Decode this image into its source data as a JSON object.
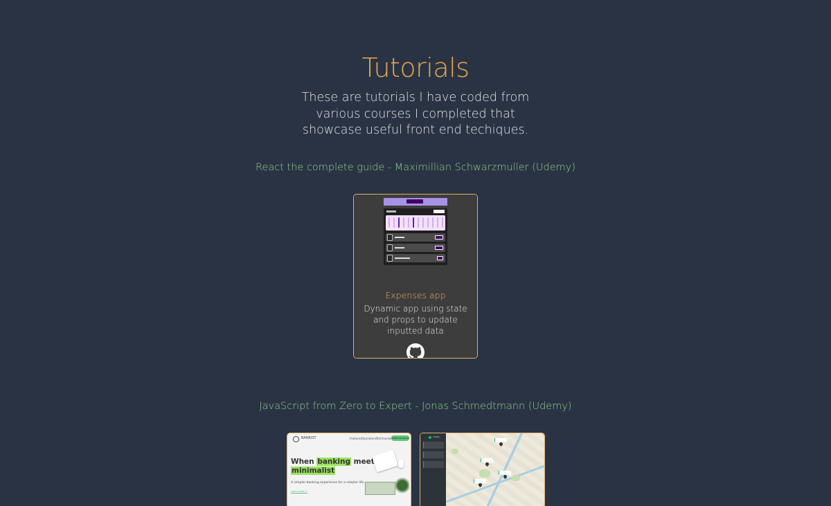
{
  "header": {
    "title": "Tutorials",
    "intro": "These are tutorials I have coded from various courses I completed that showcase useful front end techiques."
  },
  "courses": [
    {
      "heading": "React the complete guide - Maximillian Schwarzmuller (Udemy)",
      "projects": [
        {
          "title": "Expenses app",
          "description": "Dynamic app using state and props to update inputted data",
          "link_icon": "github-icon"
        }
      ]
    },
    {
      "heading": "JavaScript from Zero to Expert - Jonas Schmedtmann (Udemy)",
      "projects": [
        {
          "preview": {
            "brand": "BANKIST",
            "nav": [
              "Features",
              "Operations",
              "Testimonials"
            ],
            "nav_cta": "Open account",
            "hero_line1_pre": "When",
            "hero_line1_hl": "banking",
            "hero_line1_post": "meets",
            "hero_line2_hl": "minimalist",
            "subtitle": "A simpler banking experience for a simpler life.",
            "learn_more": "Learn more ↓"
          }
        },
        {
          "preview": {
            "brand": "mapty"
          }
        }
      ]
    }
  ],
  "colors": {
    "background": "#2a3344",
    "title_accent": "#e9a94e",
    "course_heading": "#8fd089",
    "card_border": "#e0b166"
  }
}
